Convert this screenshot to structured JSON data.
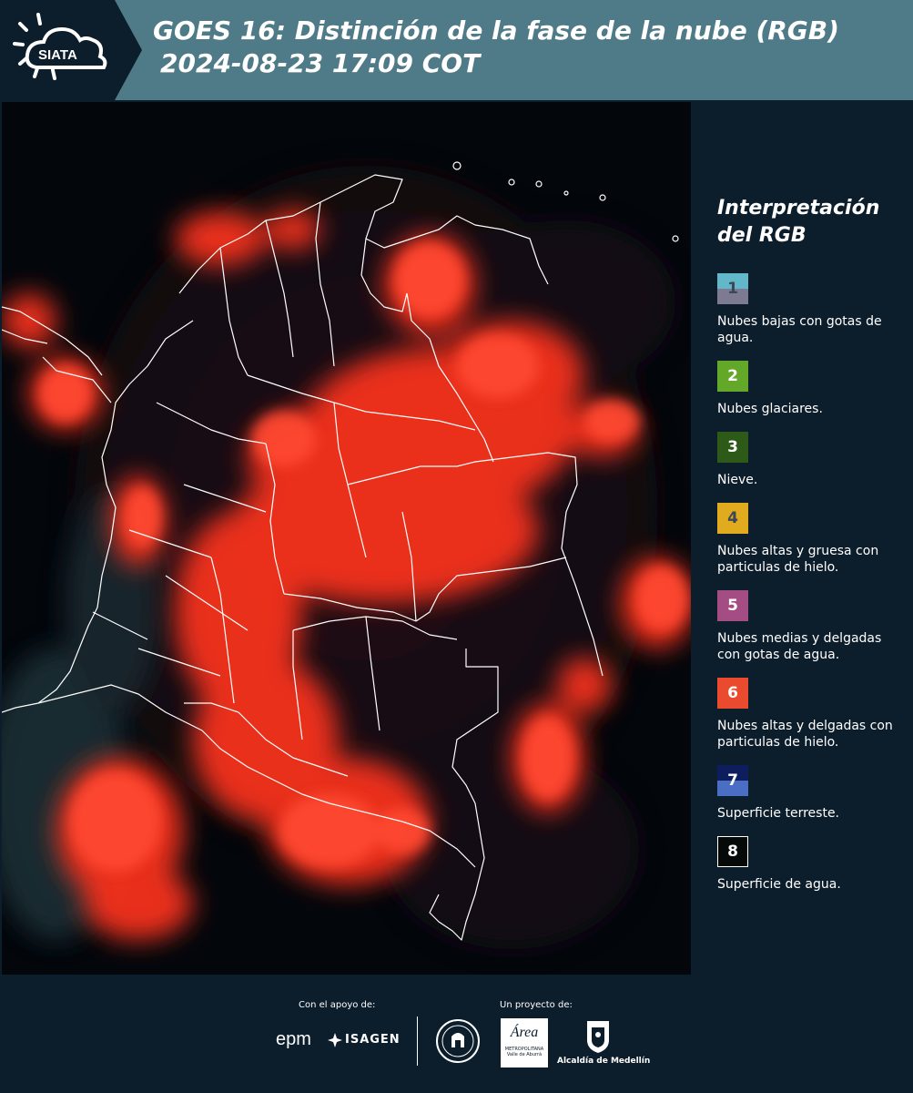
{
  "header": {
    "logo_text": "SIATA",
    "title_line1": "GOES 16: Distinción de la fase de la nube (RGB)",
    "title_line2": "2024-08-23 17:09 COT"
  },
  "legend": {
    "title": "Interpretación\ndel RGB",
    "items": [
      {
        "number": "1",
        "label": "Nubes bajas con gotas de agua.",
        "color_top": "#62b8c8",
        "color_bottom": "#7d7a93",
        "number_color": "#3b4656"
      },
      {
        "number": "2",
        "label": "Nubes glaciares.",
        "color_top": "#64a82a",
        "color_bottom": "#64a82a",
        "number_color": "#ffffff"
      },
      {
        "number": "3",
        "label": "Nieve.",
        "color_top": "#2d5a18",
        "color_bottom": "#2d5a18",
        "number_color": "#ffffff"
      },
      {
        "number": "4",
        "label": "Nubes altas y gruesa con particulas de hielo.",
        "color_top": "#e0ab1e",
        "color_bottom": "#e0ab1e",
        "number_color": "#3b4656"
      },
      {
        "number": "5",
        "label": "Nubes medias y delgadas con gotas de agua.",
        "color_top": "#a44d84",
        "color_bottom": "#a44d84",
        "number_color": "#ffffff"
      },
      {
        "number": "6",
        "label": "Nubes altas y delgadas con particulas de hielo.",
        "color_top": "#ea4a2e",
        "color_bottom": "#ea4a2e",
        "number_color": "#ffffff"
      },
      {
        "number": "7",
        "label": "Superficie terreste.",
        "color_top": "#0d1d5e",
        "color_bottom": "#4a6ec4",
        "number_color": "#ffffff"
      },
      {
        "number": "8",
        "label": "Superficie de agua.",
        "color_top": "#050a08",
        "color_bottom": "#050a08",
        "number_color": "#ffffff"
      }
    ]
  },
  "footer": {
    "support_label": "Con el apoyo de:",
    "project_label": "Un proyecto de:",
    "sponsor_epm": "epm",
    "sponsor_isagen": "ISAGEN",
    "partner_area": "Área",
    "partner_area_sub": "METROPOLITANA",
    "partner_area_sub2": "Valle de Aburrá",
    "partner_alcaldia": "Alcaldía de Medellín"
  },
  "colors": {
    "header_bg": "#4f7a87",
    "panel_bg": "#0c1d2b",
    "cloud_red": "#ff3b22",
    "border_white": "#ffffff"
  }
}
